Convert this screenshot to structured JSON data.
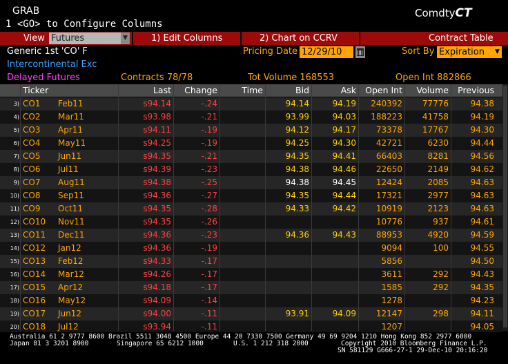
{
  "header": {
    "grab": "GRAB",
    "command": "1 <GO> to Configure Columns",
    "app_prefix": "Comdty",
    "app_suffix": "CT"
  },
  "toolbar": {
    "view_label": "View",
    "view_value": "Futures",
    "edit_columns": "1) Edit Columns",
    "chart": "2) Chart on CCRV",
    "contract_table": "Contract Table"
  },
  "info": {
    "generic": "Generic 1st 'CO' F",
    "exchange": "Intercontinental Exc",
    "delayed": "Delayed Futures",
    "pricing_label": "Pricing Date",
    "pricing_value": "12/29/10",
    "sort_label": "Sort By",
    "sort_value": "Expiration",
    "contracts": "Contracts 78/78",
    "tot_volume": "Tot Volume 168553",
    "open_int": "Open Int 882866"
  },
  "columns": [
    "Ticker",
    "Last",
    "Change",
    "Time",
    "Bid",
    "Ask",
    "Open Int",
    "Volume",
    "Previous"
  ],
  "rows": [
    {
      "n": "3)",
      "t": "CO1",
      "m": "Feb11",
      "last": "s94.14",
      "chg": "-.24",
      "bid": "94.14",
      "ask": "94.19",
      "oi": "240392",
      "vol": "77776",
      "prev": "94.38",
      "bw": false
    },
    {
      "n": "4)",
      "t": "CO2",
      "m": "Mar11",
      "last": "s93.98",
      "chg": "-.21",
      "bid": "93.99",
      "ask": "94.03",
      "oi": "188223",
      "vol": "41758",
      "prev": "94.19",
      "bw": false
    },
    {
      "n": "5)",
      "t": "CO3",
      "m": "Apr11",
      "last": "s94.11",
      "chg": "-.19",
      "bid": "94.12",
      "ask": "94.17",
      "oi": "73378",
      "vol": "17767",
      "prev": "94.30",
      "bw": false
    },
    {
      "n": "6)",
      "t": "CO4",
      "m": "May11",
      "last": "s94.25",
      "chg": "-.19",
      "bid": "94.25",
      "ask": "94.30",
      "oi": "42721",
      "vol": "6230",
      "prev": "94.44",
      "bw": false
    },
    {
      "n": "7)",
      "t": "CO5",
      "m": "Jun11",
      "last": "s94.35",
      "chg": "-.21",
      "bid": "94.35",
      "ask": "94.41",
      "oi": "66403",
      "vol": "8281",
      "prev": "94.56",
      "bw": false
    },
    {
      "n": "8)",
      "t": "CO6",
      "m": "Jul11",
      "last": "s94.39",
      "chg": "-.23",
      "bid": "94.38",
      "ask": "94.46",
      "oi": "22650",
      "vol": "2149",
      "prev": "94.62",
      "bw": false
    },
    {
      "n": "9)",
      "t": "CO7",
      "m": "Aug11",
      "last": "s94.38",
      "chg": "-.25",
      "bid": "94.38",
      "ask": "94.45",
      "oi": "12424",
      "vol": "2085",
      "prev": "94.63",
      "bw": true
    },
    {
      "n": "10)",
      "t": "CO8",
      "m": "Sep11",
      "last": "s94.36",
      "chg": "-.27",
      "bid": "94.35",
      "ask": "94.44",
      "oi": "17321",
      "vol": "2977",
      "prev": "94.63",
      "bw": false
    },
    {
      "n": "11)",
      "t": "CO9",
      "m": "Oct11",
      "last": "s94.35",
      "chg": "-.28",
      "bid": "94.33",
      "ask": "94.42",
      "oi": "10919",
      "vol": "2123",
      "prev": "94.63",
      "bw": false
    },
    {
      "n": "12)",
      "t": "CO10",
      "m": "Nov11",
      "last": "s94.35",
      "chg": "-.26",
      "bid": "",
      "ask": "",
      "oi": "10776",
      "vol": "937",
      "prev": "94.61",
      "bw": false
    },
    {
      "n": "13)",
      "t": "CO11",
      "m": "Dec11",
      "last": "s94.36",
      "chg": "-.23",
      "bid": "94.36",
      "ask": "94.43",
      "oi": "88953",
      "vol": "4920",
      "prev": "94.59",
      "bw": false
    },
    {
      "n": "14)",
      "t": "CO12",
      "m": "Jan12",
      "last": "s94.36",
      "chg": "-.19",
      "bid": "",
      "ask": "",
      "oi": "9094",
      "vol": "100",
      "prev": "94.55",
      "bw": false
    },
    {
      "n": "15)",
      "t": "CO13",
      "m": "Feb12",
      "last": "s94.33",
      "chg": "-.17",
      "bid": "",
      "ask": "",
      "oi": "5856",
      "vol": "",
      "prev": "94.50",
      "bw": false
    },
    {
      "n": "16)",
      "t": "CO14",
      "m": "Mar12",
      "last": "s94.26",
      "chg": "-.17",
      "bid": "",
      "ask": "",
      "oi": "3611",
      "vol": "292",
      "prev": "94.43",
      "bw": false
    },
    {
      "n": "17)",
      "t": "CO15",
      "m": "Apr12",
      "last": "s94.18",
      "chg": "-.17",
      "bid": "",
      "ask": "",
      "oi": "1585",
      "vol": "292",
      "prev": "94.35",
      "bw": false
    },
    {
      "n": "18)",
      "t": "CO16",
      "m": "May12",
      "last": "s94.09",
      "chg": "-.14",
      "bid": "",
      "ask": "",
      "oi": "1278",
      "vol": "",
      "prev": "94.23",
      "bw": false
    },
    {
      "n": "19)",
      "t": "CO17",
      "m": "Jun12",
      "last": "s94.00",
      "chg": "-.11",
      "bid": "93.91",
      "ask": "94.09",
      "oi": "12147",
      "vol": "298",
      "prev": "94.11",
      "bw": false
    },
    {
      "n": "20)",
      "t": "CO18",
      "m": "Jul12",
      "last": "s93.94",
      "chg": "-.11",
      "bid": "",
      "ask": "",
      "oi": "1207",
      "vol": "",
      "prev": "94.05",
      "bw": false
    }
  ],
  "footer": {
    "line1": "Australia 61 2 9777 8600 Brazil 5511 3048 4500 Europe 44 20 7330 7500 Germany 49 69 9204 1210 Hong Kong 852 2977 6000",
    "line2a": "Japan 81 3 3201 8900",
    "line2b": "Singapore 65 6212 1000",
    "line2c": "U.S. 1 212 318 2000",
    "line2d": "Copyright 2010 Bloomberg Finance L.P.",
    "line3": "SN 581129 G666-27-1 29-Dec-10 20:16:20"
  }
}
